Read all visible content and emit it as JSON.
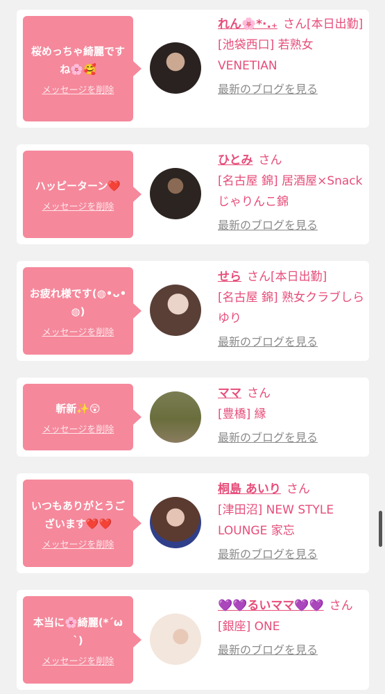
{
  "delete_label": "メッセージを削除",
  "blog_label": "最新のブログを見る",
  "san_label": "さん",
  "items": [
    {
      "message": "桜めっちゃ綺麗ですね🌸🥰",
      "name": "れん🌸*·.₊",
      "status": "[本日出勤]",
      "shop": "[池袋西口] 若熟女VENETIAN"
    },
    {
      "message": "ハッピーターン❤️",
      "name": "ひとみ",
      "status": "",
      "shop": "[名古屋 錦] 居酒屋×Snack じゃりんこ錦"
    },
    {
      "message": "お疲れ様です(◍•ᴗ•◍)",
      "name": "せら",
      "status": "[本日出勤]",
      "shop": "[名古屋 錦] 熟女クラブしらゆり"
    },
    {
      "message": "斬新✨😲",
      "name": "ママ",
      "status": "",
      "shop": "[豊橋] 縁"
    },
    {
      "message": "いつもありがとうございます❤️❤️",
      "name": "桐島 あいり",
      "status": "",
      "shop": "[津田沼] NEW STYLE LOUNGE 家忘"
    },
    {
      "message": "本当に🌸綺麗(*´ω`)",
      "name": "💜💜るいママ💜💜",
      "status": "",
      "shop": "[銀座] ONE"
    }
  ],
  "colors": {
    "accent": "#e64d7a",
    "bubble": "#f5889b",
    "background": "#f1f1f1"
  }
}
